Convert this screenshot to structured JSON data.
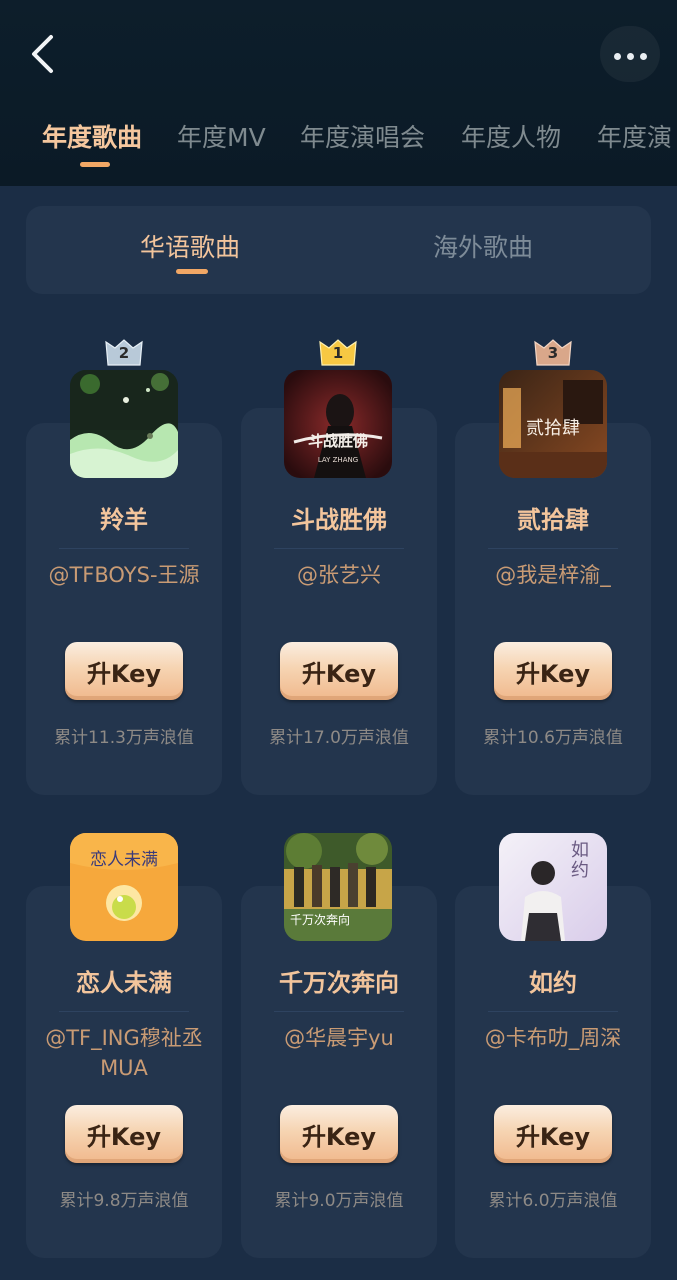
{
  "header": {
    "tabs": [
      {
        "label": "年度歌曲"
      },
      {
        "label": "年度MV"
      },
      {
        "label": "年度演唱会"
      },
      {
        "label": "年度人物"
      },
      {
        "label": "年度演"
      }
    ]
  },
  "sub_tabs": [
    {
      "label": "华语歌曲"
    },
    {
      "label": "海外歌曲"
    }
  ],
  "colors": {
    "accent": "#f3c59c",
    "underline": "#f1a765",
    "card_bg": "#23354d",
    "page_bg": "#1b2d45"
  },
  "songs": [
    {
      "rank": "2",
      "title": "羚羊",
      "artist": "@TFBOYS-王源",
      "button": "升Key",
      "score": "累计11.3万声浪值"
    },
    {
      "rank": "1",
      "title": "斗战胜佛",
      "artist": "@张艺兴",
      "button": "升Key",
      "score": "累计17.0万声浪值",
      "cover_text": "斗战胜佛",
      "cover_sub": "LAY ZHANG"
    },
    {
      "rank": "3",
      "title": "贰拾肆",
      "artist": "@我是梓渝_",
      "button": "升Key",
      "score": "累计10.6万声浪值",
      "cover_text": "贰拾肆"
    },
    {
      "title": "恋人未满",
      "artist": "@TF_ING穆祉丞MUA",
      "button": "升Key",
      "score": "累计9.8万声浪值",
      "cover_text": "恋人未满"
    },
    {
      "title": "千万次奔向",
      "artist": "@华晨宇yu",
      "button": "升Key",
      "score": "累计9.0万声浪值",
      "cover_text": "千万次奔向"
    },
    {
      "title": "如约",
      "artist": "@卡布叻_周深",
      "button": "升Key",
      "score": "累计6.0万声浪值",
      "cover_text": "如约"
    }
  ]
}
